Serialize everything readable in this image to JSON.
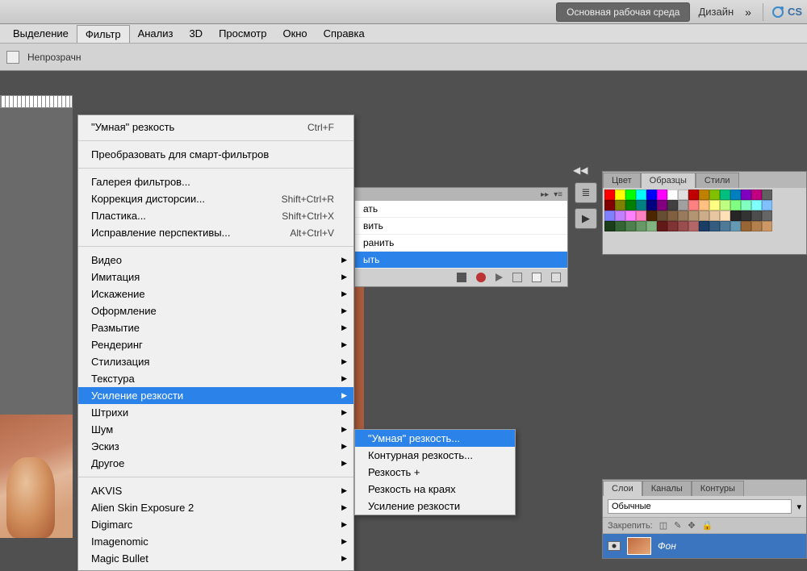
{
  "topbar": {
    "workspace_active": "Основная рабочая среда",
    "workspace_design": "Дизайн",
    "cs_label": "CS"
  },
  "menubar": {
    "items": [
      "Выделение",
      "Фильтр",
      "Анализ",
      "3D",
      "Просмотр",
      "Окно",
      "Справка"
    ],
    "active_index": 1
  },
  "options": {
    "opacity_label": "Непрозрачн"
  },
  "filter_menu": {
    "recent": {
      "label": "\"Умная\" резкость",
      "shortcut": "Ctrl+F"
    },
    "convert_smart": "Преобразовать для смарт-фильтров",
    "group1": [
      {
        "label": "Галерея фильтров..."
      },
      {
        "label": "Коррекция дисторсии...",
        "shortcut": "Shift+Ctrl+R"
      },
      {
        "label": "Пластика...",
        "shortcut": "Shift+Ctrl+X"
      },
      {
        "label": "Исправление перспективы...",
        "shortcut": "Alt+Ctrl+V"
      }
    ],
    "group2": [
      "Видео",
      "Имитация",
      "Искажение",
      "Оформление",
      "Размытие",
      "Рендеринг",
      "Стилизация",
      "Текстура",
      "Усиление резкости",
      "Штрихи",
      "Шум",
      "Эскиз",
      "Другое"
    ],
    "group2_hover_index": 8,
    "group3": [
      "AKVIS",
      "Alien Skin Exposure 2",
      "Digimarc",
      "Imagenomic",
      "Magic Bullet"
    ]
  },
  "sharpen_submenu": {
    "items": [
      "\"Умная\" резкость...",
      "Контурная резкость...",
      "Резкость +",
      "Резкость на краях",
      "Усиление резкости"
    ],
    "hover_index": 0
  },
  "actions_fragment": {
    "rows": [
      "ать",
      "вить",
      "ранить",
      "ыть"
    ],
    "selected_index": 3
  },
  "swatch_tabs": [
    "Цвет",
    "Образцы",
    "Стили"
  ],
  "swatch_active_tab": 1,
  "swatch_colors": [
    "#ff0000",
    "#ffff00",
    "#00ff00",
    "#00ffff",
    "#0000ff",
    "#ff00ff",
    "#ffffff",
    "#e0e0e0",
    "#c00000",
    "#c08000",
    "#80c000",
    "#00c080",
    "#0080c0",
    "#8000c0",
    "#c00080",
    "#606060",
    "#800000",
    "#808000",
    "#008000",
    "#008080",
    "#000080",
    "#800080",
    "#404040",
    "#a0a0a0",
    "#ff8080",
    "#ffc080",
    "#ffff80",
    "#c0ff80",
    "#80ff80",
    "#80ffc0",
    "#80ffff",
    "#80c0ff",
    "#8080ff",
    "#c080ff",
    "#ff80ff",
    "#ff80c0",
    "#4d2600",
    "#664d33",
    "#806040",
    "#997a5c",
    "#b39473",
    "#ccad8a",
    "#e6c7a1",
    "#ffe0b8",
    "#262626",
    "#333333",
    "#4d4d4d",
    "#666666",
    "#1a3d1a",
    "#336633",
    "#4d804d",
    "#669966",
    "#80b380",
    "#641919",
    "#803333",
    "#994d4d",
    "#b36666",
    "#193d64",
    "#335c80",
    "#4d7a99",
    "#6699b3",
    "#996633",
    "#b3804d",
    "#cc9966"
  ],
  "layers_panel": {
    "tabs": [
      "Слои",
      "Каналы",
      "Контуры"
    ],
    "active_tab": 0,
    "blend_mode": "Обычные",
    "lock_label": "Закрепить:",
    "layer_name": "Фон"
  }
}
